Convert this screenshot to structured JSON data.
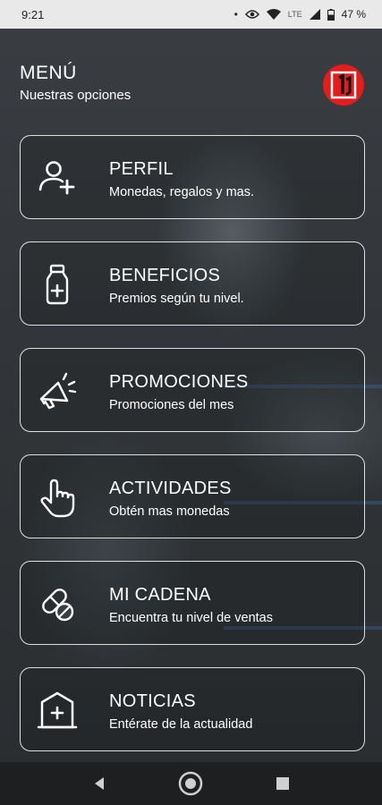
{
  "status_bar": {
    "time": "9:21",
    "network": "LTE",
    "battery": "47 %"
  },
  "header": {
    "title": "MENÚ",
    "subtitle": "Nuestras opciones"
  },
  "menu": {
    "items": [
      {
        "title": "PERFIL",
        "description": "Monedas, regalos y mas.",
        "icon": "add-user-icon"
      },
      {
        "title": "BENEFICIOS",
        "description": "Premios según tu nivel.",
        "icon": "medicine-bottle-icon"
      },
      {
        "title": "PROMOCIONES",
        "description": "Promociones del mes",
        "icon": "megaphone-icon"
      },
      {
        "title": "ACTIVIDADES",
        "description": "Obtén mas monedas",
        "icon": "pointing-hand-icon"
      },
      {
        "title": "MI CADENA",
        "description": "Encuentra tu nivel de ventas",
        "icon": "pills-icon"
      },
      {
        "title": "NOTICIAS",
        "description": "Entérate de la actualidad",
        "icon": "pharmacy-building-icon"
      }
    ]
  },
  "colors": {
    "logo": "#e31c1c",
    "card_border": "#ffffff",
    "status_bar_bg": "#e9e9e9",
    "nav_bar_bg": "#1e1f21"
  }
}
